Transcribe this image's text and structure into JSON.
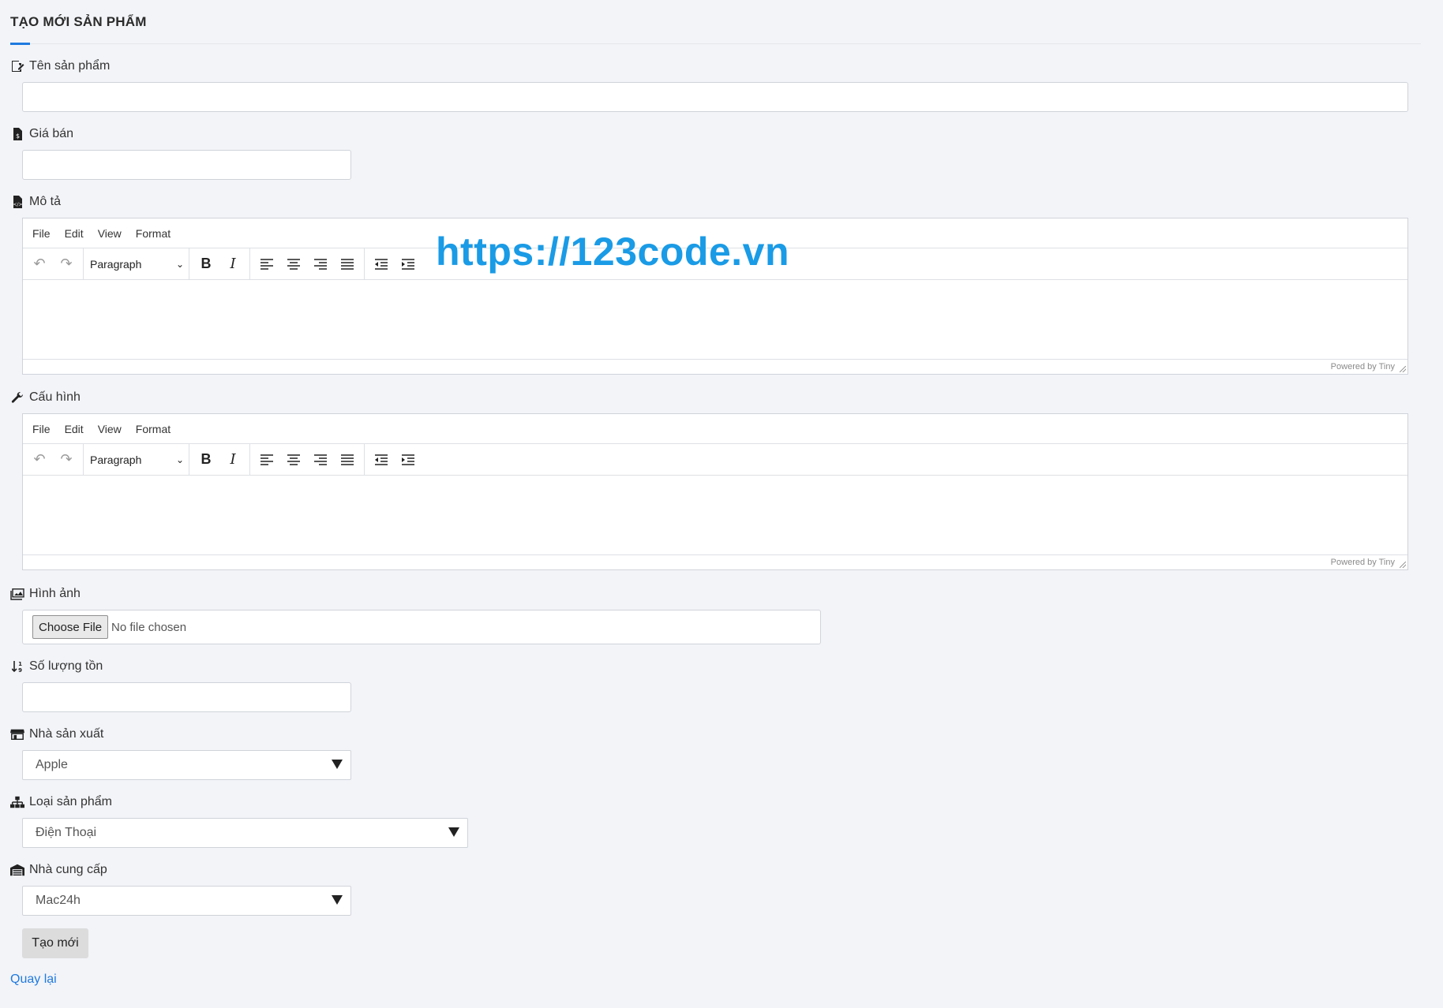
{
  "page": {
    "title": "TẠO MỚI SẢN PHẨM"
  },
  "accent_color": "#1f7ae0",
  "watermark": "https://123code.vn",
  "fields": {
    "name": {
      "label": "Tên sản phẩm",
      "icon": "edit-document-icon",
      "value": ""
    },
    "price": {
      "label": "Giá bán",
      "icon": "dollar-file-icon",
      "value": ""
    },
    "description": {
      "label": "Mô tả",
      "icon": "code-file-icon"
    },
    "config": {
      "label": "Cấu hình",
      "icon": "wrench-icon"
    },
    "image": {
      "label": "Hình ảnh",
      "icon": "images-icon",
      "button": "Choose File",
      "status": "No file chosen"
    },
    "stock": {
      "label": "Số lượng tồn",
      "icon": "sort-numeric-icon",
      "value": ""
    },
    "manufacturer": {
      "label": "Nhà sản xuất",
      "icon": "store-icon",
      "selected": "Apple"
    },
    "category": {
      "label": "Loại sản phẩm",
      "icon": "sitemap-icon",
      "selected": "Điện Thoại"
    },
    "supplier": {
      "label": "Nhà cung cấp",
      "icon": "warehouse-icon",
      "selected": "Mac24h"
    }
  },
  "editor": {
    "menu": [
      "File",
      "Edit",
      "View",
      "Format"
    ],
    "block_format": "Paragraph",
    "powered_by": "Powered by Tiny"
  },
  "actions": {
    "submit": "Tạo mới",
    "back": "Quay lại"
  }
}
